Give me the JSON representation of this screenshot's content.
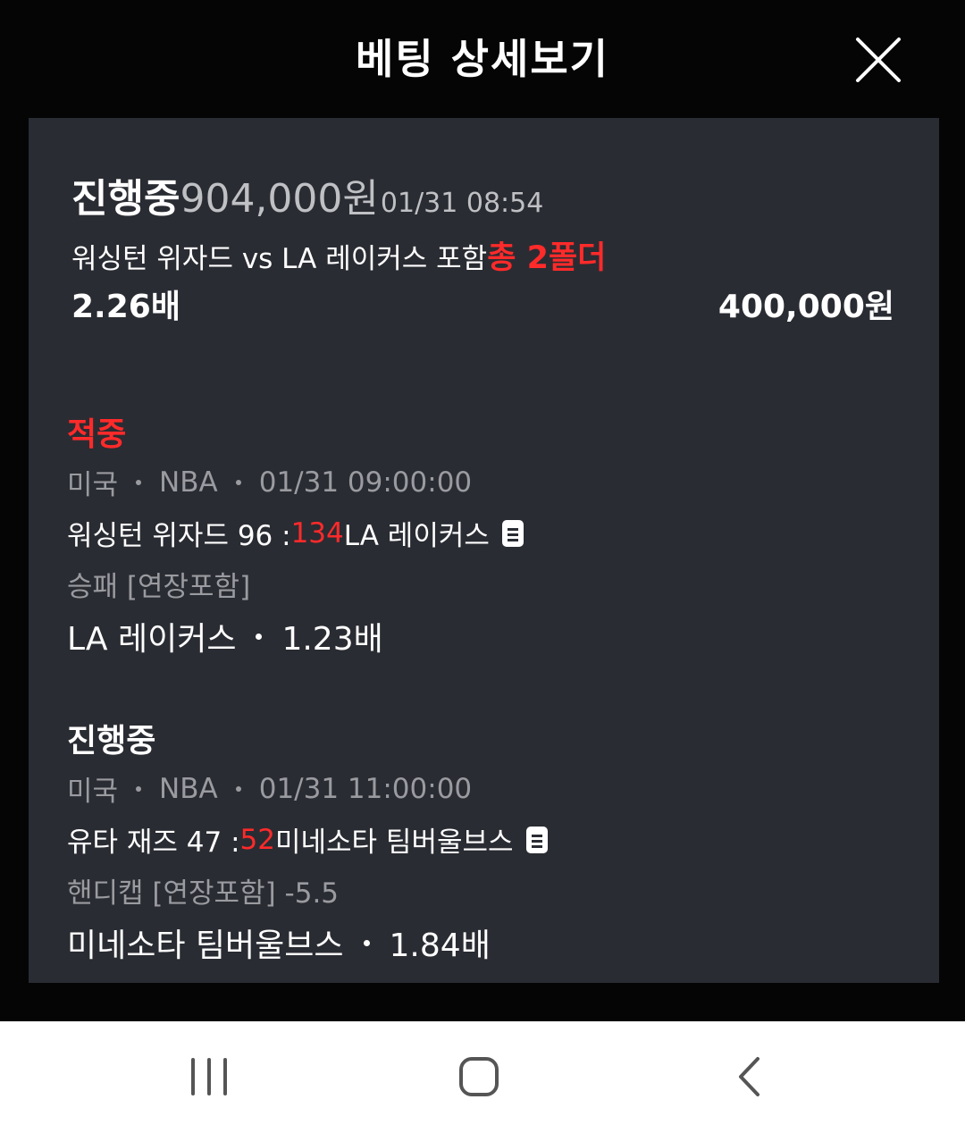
{
  "header": {
    "title": "베팅 상세보기",
    "close_icon": "close-icon"
  },
  "summary": {
    "status": "진행중",
    "amount": "904,000원",
    "datetime": "01/31 08:54",
    "match": "워싱턴 위자드 vs LA 레이커스 포함",
    "total_folders": "총 2폴더",
    "odds": "2.26배",
    "stake": "400,000원"
  },
  "bets": [
    {
      "status": "적중",
      "country": "미국",
      "league": "NBA",
      "datetime": "01/31 09:00:00",
      "home_score_text": "워싱턴 위자드 96 :",
      "away_score": "134",
      "away_team": "LA 레이커스",
      "market": "승패 [연장포함]",
      "pick": "LA 레이커스",
      "pick_odds": "1.23배"
    },
    {
      "status": "진행중",
      "country": "미국",
      "league": "NBA",
      "datetime": "01/31 11:00:00",
      "home_score_text": "유타 재즈 47 :",
      "away_score": "52",
      "away_team": "미네소타 팀버울브스",
      "market": "핸디캡 [연장포함] -5.5",
      "pick": "미네소타 팀버울브스",
      "pick_odds": "1.84배"
    }
  ],
  "navigation_bar": {
    "recent_apps_icon": "recent-apps-icon",
    "home_icon": "home-icon",
    "back_icon": "back-icon"
  },
  "colors": {
    "background": "#050505",
    "card": "#2a2c33",
    "accent_red": "#ff2a2a",
    "muted_text": "#9a9ba0"
  }
}
